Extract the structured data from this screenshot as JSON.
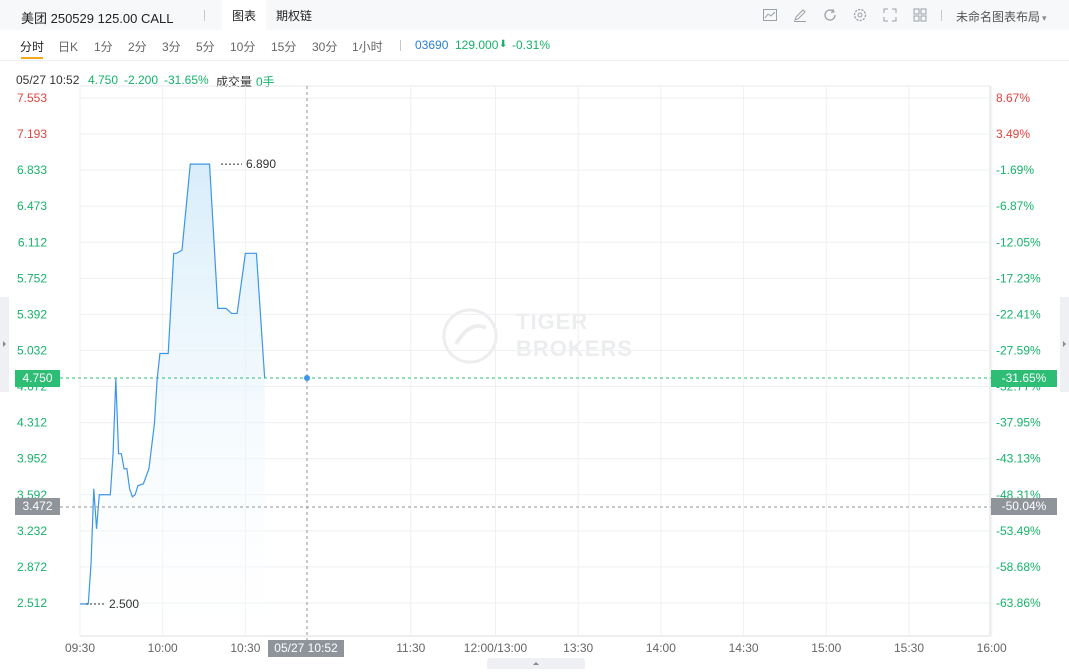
{
  "header": {
    "title": "美团 250529 125.00 CALL",
    "tabs": [
      {
        "label": "图表"
      },
      {
        "label": "期权链"
      }
    ],
    "toolbar_icons": [
      "chart-icon",
      "draw-icon",
      "refresh-icon",
      "settings-icon",
      "fullscreen-icon",
      "grid-layout-icon"
    ],
    "layout_label": "未命名图表布局",
    "layout_caret": "▾"
  },
  "periods": [
    "分时",
    "日K",
    "1分",
    "2分",
    "3分",
    "5分",
    "10分",
    "15分",
    "30分",
    "1小时"
  ],
  "underlying": {
    "code": "03690",
    "price": "129.000",
    "arrow": "⬇",
    "change": "-0.31%"
  },
  "info": {
    "datetime": "05/27 10:52",
    "price": "4.750",
    "change": "-2.200",
    "change_pct": "-31.65%",
    "volume_label": "成交量",
    "volume": "0手"
  },
  "y_left_ticks": [
    "7.553",
    "7.193",
    "6.833",
    "6.473",
    "6.112",
    "5.752",
    "5.392",
    "5.032",
    "4.672",
    "4.312",
    "3.952",
    "3.592",
    "3.232",
    "2.872",
    "2.512"
  ],
  "y_right_ticks": [
    "8.67%",
    "3.49%",
    "-1.69%",
    "-6.87%",
    "-12.05%",
    "-17.23%",
    "-22.41%",
    "-27.59%",
    "-32.77%",
    "-37.95%",
    "-43.13%",
    "-48.31%",
    "-53.49%",
    "-58.68%",
    "-63.86%"
  ],
  "x_ticks": [
    "09:30",
    "10:00",
    "10:30",
    "11:30",
    "12:00/13:00",
    "13:30",
    "14:00",
    "14:30",
    "15:00",
    "15:30",
    "16:00"
  ],
  "crosshair": {
    "time": "05/27 10:52",
    "price": "4.750",
    "pct": "-31.65%"
  },
  "prev_close": {
    "price": "3.472",
    "pct": "-50.04%"
  },
  "annotations": {
    "high": "6.890",
    "low": "2.500"
  },
  "watermark": {
    "line1": "TIGER",
    "line2": "BROKERS"
  },
  "colors": {
    "line": "#3d96e6",
    "fill": "#d6ecfa",
    "up": "#e0433d",
    "down": "#17b26a",
    "crosshair_badge": "#2ebd75",
    "prev_badge": "#8f939a"
  },
  "chart_data": {
    "type": "line",
    "title": "",
    "xlabel": "",
    "ylabel": "",
    "ylim": [
      2.51,
      7.55
    ],
    "x_range": [
      "09:30",
      "16:00"
    ],
    "series": [
      {
        "x": [
          "09:30",
          "09:33",
          "09:34",
          "09:35",
          "09:36",
          "09:37",
          "09:38",
          "09:39",
          "09:41",
          "09:42",
          "09:43",
          "09:44",
          "09:45",
          "09:46",
          "09:47",
          "09:48",
          "09:49",
          "09:50",
          "09:51",
          "09:53",
          "09:55",
          "09:57",
          "09:58",
          "09:59",
          "10:00",
          "10:02",
          "10:04",
          "10:05",
          "10:07",
          "10:10",
          "10:11",
          "10:17",
          "10:20",
          "10:23",
          "10:25",
          "10:27",
          "10:30",
          "10:34",
          "10:37"
        ],
        "values": [
          2.5,
          2.5,
          2.9,
          3.65,
          3.25,
          3.59,
          3.59,
          3.59,
          3.59,
          4.0,
          4.75,
          4.0,
          4.0,
          3.85,
          3.85,
          3.65,
          3.57,
          3.59,
          3.68,
          3.7,
          3.85,
          4.3,
          4.75,
          5.0,
          5.0,
          5.0,
          6.0,
          6.0,
          6.03,
          6.89,
          6.89,
          6.89,
          5.45,
          5.45,
          5.4,
          5.4,
          6.0,
          6.0,
          4.75
        ]
      }
    ]
  }
}
